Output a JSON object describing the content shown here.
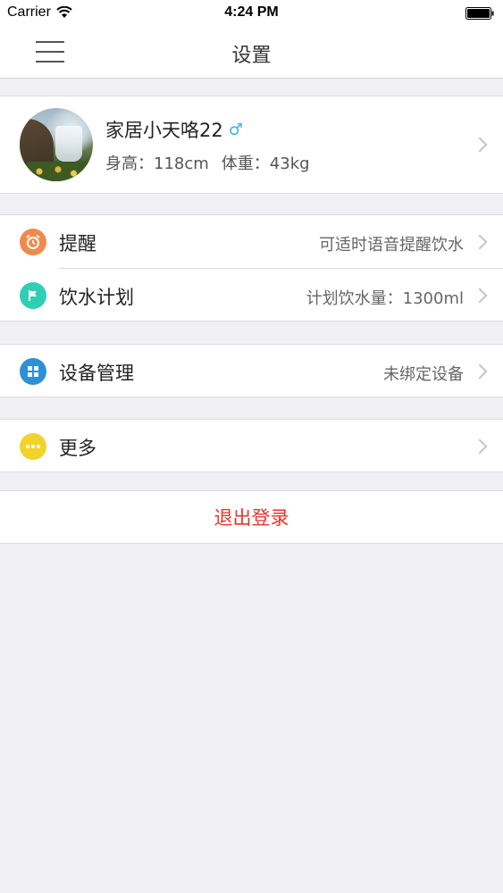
{
  "status_bar": {
    "carrier": "Carrier",
    "time": "4:24 PM"
  },
  "nav": {
    "title": "设置"
  },
  "profile": {
    "name": "家居小天咯22",
    "gender_symbol": "♂",
    "height": "身高：118cm",
    "weight": "体重：43kg"
  },
  "menu": {
    "reminder": {
      "label": "提醒",
      "value": "可适时语音提醒饮水",
      "icon": "alarm-clock-icon",
      "color": "#f08a4b"
    },
    "plan": {
      "label": "饮水计划",
      "value": "计划饮水量：1300ml",
      "icon": "flag-icon",
      "color": "#2fcfb6"
    },
    "device": {
      "label": "设备管理",
      "value": "未绑定设备",
      "icon": "grid-icon",
      "color": "#2e8fd6"
    },
    "more": {
      "label": "更多",
      "value": "",
      "icon": "dots-icon",
      "color": "#f2d32b"
    }
  },
  "logout": {
    "label": "退出登录",
    "color": "#e8332d"
  }
}
